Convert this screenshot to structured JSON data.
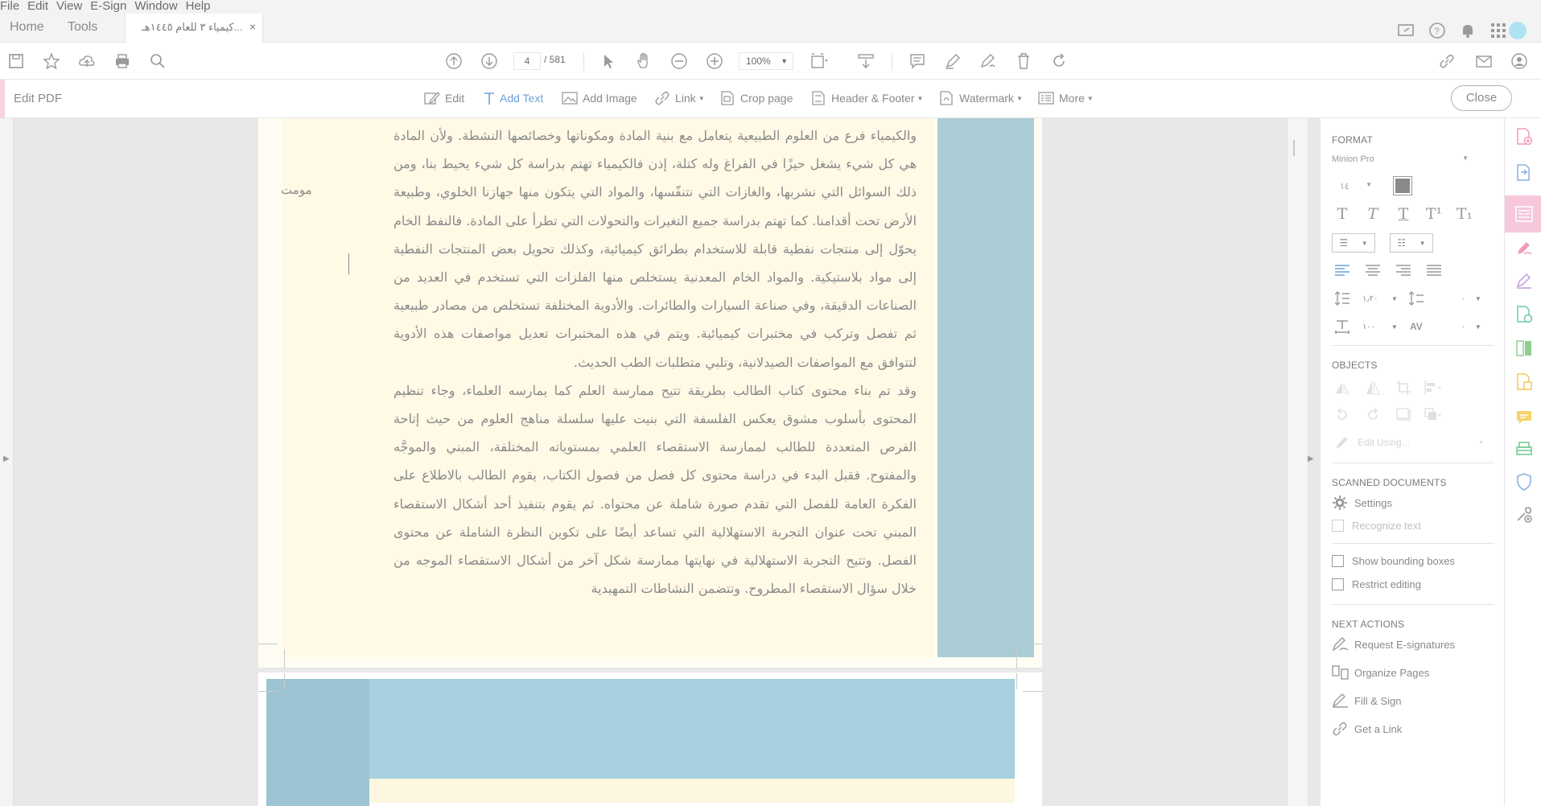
{
  "menu": [
    "File",
    "Edit",
    "View",
    "E-Sign",
    "Window",
    "Help"
  ],
  "tabs": {
    "home": "Home",
    "tools": "Tools",
    "document": "كيمياء ٣ للعام ١٤٤٥هـ..."
  },
  "toolbar": {
    "page_current": "4",
    "page_total": "/ 581",
    "zoom": "100%"
  },
  "edit_bar": {
    "title": "Edit PDF",
    "tools": [
      "Edit",
      "Add Text",
      "Add Image",
      "Link",
      "Crop page",
      "Header & Footer",
      "Watermark",
      "More"
    ],
    "active_tool": "Add Text",
    "close": "Close"
  },
  "document": {
    "side_word": "مومت",
    "paragraph1": "والكيمياء فرع من العلوم الطبيعية يتعامل مع بنية المادة ومكوناتها وخصائصها النشطة. ولأن المادة هي كل شيء يشغل حيزًا في الفراغ وله كتلة، إذن فالكيمياء تهتم بدراسة كل شيء يحيط بنا، ومن ذلك السوائل التي نشربها، والغازات التي نتنفّسها، والمواد التي يتكون منها جهازنا الخلوي، وطبيعة الأرض تحت أقدامنا. كما تهتم بدراسة جميع التغيرات والتحولات التي تطرأ على المادة. فالنفط الخام يحوّل إلى منتجات نفطية قابلة للاستخدام بطرائق كيميائية، وكذلك تحويل بعض المنتجات النفطية إلى مواد بلاستيكية. والمواد الخام المعدنية يستخلص منها الفلزات التي تستخدم في العديد من الصناعات الدقيقة، وفي صناعة السيارات والطائرات. والأدوية المختلفة تستخلص من مصادر طبيعية ثم تفصل وتركب في مختبرات كيميائية. ويتم في هذه المختبرات تعديل مواصفات هذه الأدوية لتتوافق مع المواصفات الصيدلانية، وتلبي متطلبات الطب الحديث.",
    "paragraph2": "وقد تم بناء محتوى كتاب الطالب بطريقة تتيح ممارسة العلم كما يمارسه العلماء، وجاء تنظيم المحتوى بأسلوب مشوق يعكس الفلسفة التي بنيت عليها سلسلة مناهج العلوم من حيث إتاحة الفرص المتعددة للطالب لممارسة الاستقصاء العلمي بمستوياته المختلفة، المبني والموجَّه والمفتوح. فقبل البدء في دراسة محتوى كل فصل من فصول الكتاب، يقوم الطالب بالاطلاع على الفكرة العامة للفصل التي تقدم صورة شاملة عن محتواه. ثم يقوم بتنفيذ أحد أشكال الاستقصاء المبني تحت عنوان التجربة الاستهلالية التي تساعد أيضًا على تكوين النظرة الشاملة عن محتوى الفصل. وتتيح التجربة الاستهلالية في نهايتها ممارسة شكل آخر من أشكال الاستقصاء الموجه من خلال سؤال الاستقصاء المطروح. وتتضمن النشاطات التمهيدية"
  },
  "panel": {
    "format_heading": "FORMAT",
    "font": "Minion Pro",
    "font_size": "١٤",
    "line_spacing": "١٫٢٠",
    "para_spacing": "٠",
    "h_scale": "١٠٠",
    "char_spacing": "٠",
    "objects_heading": "OBJECTS",
    "edit_using": "Edit Using...",
    "scanned_heading": "SCANNED DOCUMENTS",
    "settings": "Settings",
    "recognize": "Recognize text",
    "show_boxes": "Show bounding boxes",
    "restrict": "Restrict editing",
    "next_heading": "NEXT ACTIONS",
    "actions": [
      "Request E-signatures",
      "Organize Pages",
      "Fill & Sign",
      "Get a Link"
    ]
  },
  "colors": {
    "accent_pink": "#f7c8dc",
    "page_blue": "#a9ccd5",
    "link_blue": "#6fa0d8"
  }
}
